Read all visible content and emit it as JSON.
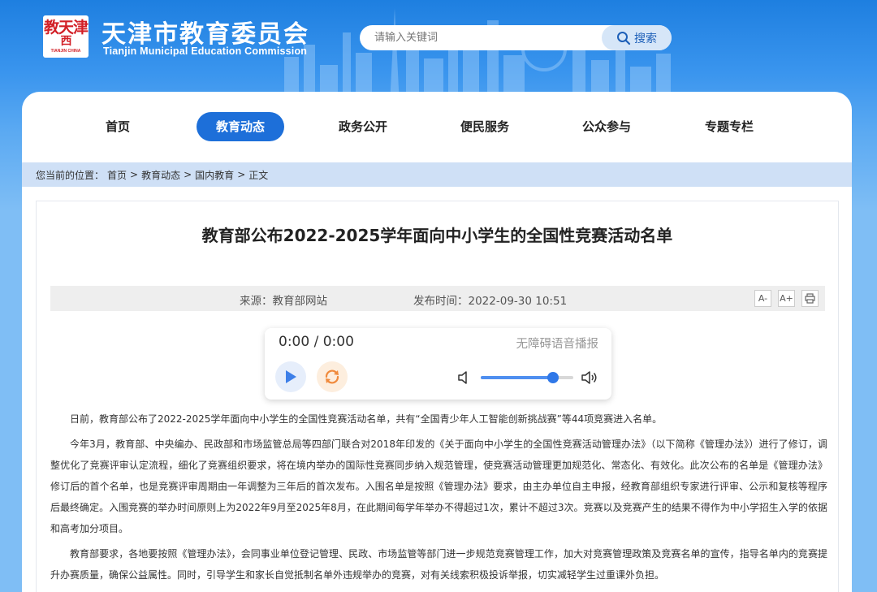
{
  "site": {
    "logo_glyph_1": "天津",
    "logo_glyph_2": "教",
    "logo_sub": "TIANJIN CHINA",
    "title": "天津市教育委员会",
    "subtitle": "Tianjin Municipal Education Commission"
  },
  "search": {
    "placeholder": "请输入关键词",
    "button_label": "搜索"
  },
  "nav": {
    "items": [
      {
        "label": "首页"
      },
      {
        "label": "教育动态"
      },
      {
        "label": "政务公开"
      },
      {
        "label": "便民服务"
      },
      {
        "label": "公众参与"
      },
      {
        "label": "专题专栏"
      }
    ],
    "active": "教育动态"
  },
  "breadcrumb": {
    "prefix": "您当前的位置：",
    "items": [
      "首页",
      "教育动态",
      "国内教育",
      "正文"
    ],
    "separator": ">"
  },
  "article": {
    "title": "教育部公布2022-2025学年面向中小学生的全国性竞赛活动名单",
    "source_label": "来源：",
    "source": "教育部网站",
    "time_label": "发布时间：",
    "time": "2022-09-30 10:51",
    "tools": [
      "A-",
      "A+",
      "print"
    ],
    "paragraphs": [
      "日前，教育部公布了2022-2025学年面向中小学生的全国性竞赛活动名单，共有“全国青少年人工智能创新挑战赛”等44项竞赛进入名单。",
      "今年3月，教育部、中央编办、民政部和市场监管总局等四部门联合对2018年印发的《关于面向中小学生的全国性竞赛活动管理办法》（以下简称《管理办法》）进行了修订，调整优化了竞赛评审认定流程，细化了竞赛组织要求，将在境内举办的国际性竞赛同步纳入规范管理，使竞赛活动管理更加规范化、常态化、有效化。此次公布的名单是《管理办法》修订后的首个名单，也是竞赛评审周期由一年调整为三年后的首次发布。入围名单是按照《管理办法》要求，由主办单位自主申报，经教育部组织专家进行评审、公示和复核等程序后最终确定。入围竞赛的举办时间原则上为2022年9月至2025年8月，在此期间每学年举办不得超过1次，累计不超过3次。竞赛以及竞赛产生的结果不得作为中小学招生入学的依据和高考加分项目。",
      "教育部要求，各地要按照《管理办法》，会同事业单位登记管理、民政、市场监管等部门进一步规范竞赛管理工作，加大对竞赛管理政策及竞赛名单的宣传，指导名单内的竞赛提升办赛质量，确保公益属性。同时，引导学生和家长自觉抵制名单外违规举办的竞赛，对有关线索积极投诉举报，切实减轻学生过重课外负担。"
    ]
  },
  "player": {
    "time": "0:00 / 0:00",
    "label": "无障碍语音播报",
    "volume": 0.78
  },
  "colors": {
    "brand_blue": "#1d6fd9",
    "logo_red": "#d21f26",
    "crumb_bg": "#cfe0f6"
  }
}
